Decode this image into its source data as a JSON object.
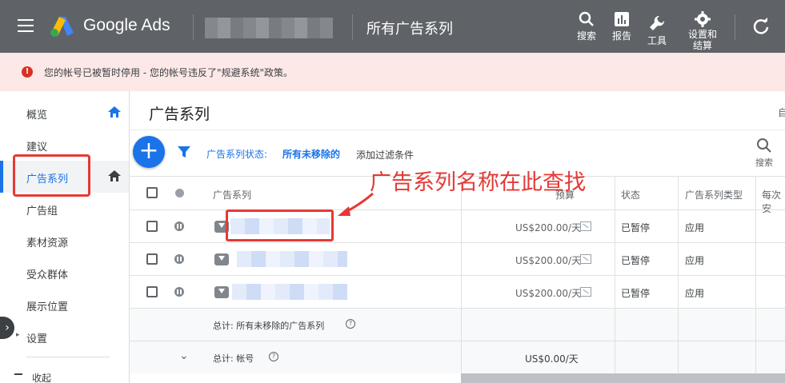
{
  "topbar": {
    "brand": "Google Ads",
    "page_title": "所有广告系列",
    "search_label": "搜索",
    "reports_label": "报告",
    "tools_label": "工具",
    "settings_label": "设置和\n结算",
    "bg_color": "#5f6368"
  },
  "banner": {
    "text": "您的帐号已被暂时停用 - 您的帐号违反了\"规避系统\"政策。",
    "bg_color": "#fce8e6",
    "icon": "error-icon"
  },
  "sidebar": {
    "items": [
      {
        "label": "概览",
        "home": true
      },
      {
        "label": "建议",
        "home": false
      },
      {
        "label": "广告系列",
        "home": true,
        "active": true
      },
      {
        "label": "广告组",
        "home": false
      },
      {
        "label": "素材资源",
        "home": false
      },
      {
        "label": "受众群体",
        "home": false
      },
      {
        "label": "展示位置",
        "home": false
      },
      {
        "label": "设置",
        "home": false
      }
    ],
    "collapse_label": "收起"
  },
  "main": {
    "title": "广告系列",
    "auto_text": "自",
    "filter_label": "广告系列状态:",
    "filter_value": "所有未移除的",
    "add_filter": "添加过滤条件",
    "search_label": "搜索"
  },
  "annotation": {
    "text": "广告系列名称在此查找",
    "color": "#e53935"
  },
  "table": {
    "headers": {
      "campaign": "广告系列",
      "budget": "预算",
      "status": "状态",
      "type": "广告系列类型",
      "cost_per": "每次安"
    },
    "rows": [
      {
        "budget": "US$200.00/天",
        "status": "已暂停",
        "type": "应用"
      },
      {
        "budget": "US$200.00/天",
        "status": "已暂停",
        "type": "应用"
      },
      {
        "budget": "US$200.00/天",
        "status": "已暂停",
        "type": "应用"
      }
    ],
    "total_campaigns": "总计: 所有未移除的广告系列",
    "total_account": "总计: 帐号",
    "total_account_budget": "US$0.00/天"
  },
  "accent_color": "#1a73e8"
}
